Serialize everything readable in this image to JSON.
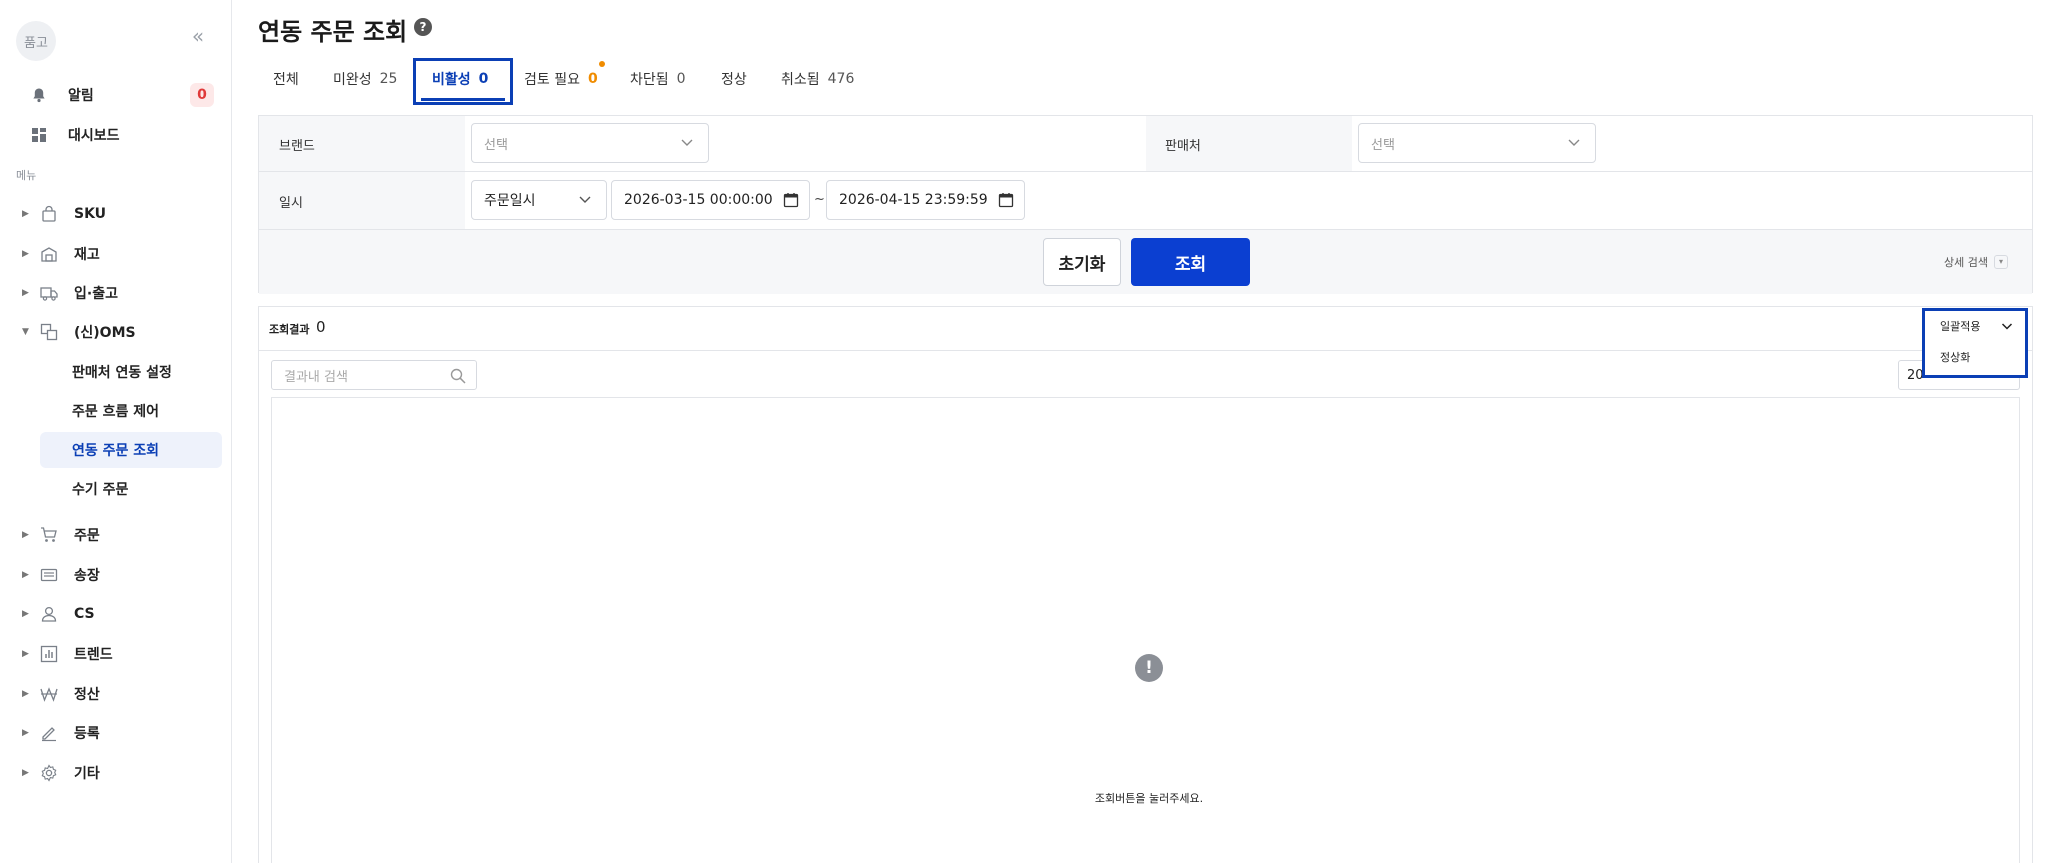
{
  "sidebar": {
    "brand": "품고",
    "notification_label": "알림",
    "notification_count": "0",
    "dashboard_label": "대시보드",
    "section_label": "메뉴",
    "items": [
      {
        "label": "SKU",
        "icon": "bag-icon"
      },
      {
        "label": "재고",
        "icon": "warehouse-icon"
      },
      {
        "label": "입·출고",
        "icon": "truck-icon"
      },
      {
        "label": "(신)OMS",
        "icon": "oms-icon"
      },
      {
        "label": "주문",
        "icon": "cart-icon"
      },
      {
        "label": "송장",
        "icon": "invoice-icon"
      },
      {
        "label": "CS",
        "icon": "user-icon"
      },
      {
        "label": "트렌드",
        "icon": "chart-icon"
      },
      {
        "label": "정산",
        "icon": "won-icon"
      },
      {
        "label": "등록",
        "icon": "pencil-icon"
      },
      {
        "label": "기타",
        "icon": "gear-icon"
      }
    ],
    "oms_subitems": [
      {
        "label": "판매처 연동 설정"
      },
      {
        "label": "주문 흐름 제어"
      },
      {
        "label": "연동 주문 조회"
      },
      {
        "label": "수기 주문"
      }
    ]
  },
  "header": {
    "title": "연동 주문 조회"
  },
  "tabs": [
    {
      "label": "전체",
      "count": ""
    },
    {
      "label": "미완성",
      "count": "25"
    },
    {
      "label": "비활성",
      "count": "0"
    },
    {
      "label": "검토 필요",
      "count": "0"
    },
    {
      "label": "차단됨",
      "count": "0"
    },
    {
      "label": "정상",
      "count": ""
    },
    {
      "label": "취소됨",
      "count": "476"
    }
  ],
  "filters": {
    "brand_label": "브랜드",
    "brand_placeholder": "선택",
    "seller_label": "판매처",
    "seller_placeholder": "선택",
    "date_label": "일시",
    "date_type": "주문일시",
    "date_from": "2026-03-15 00:00:00",
    "date_to": "2026-04-15 23:59:59",
    "tilde": "~",
    "reset_label": "초기화",
    "search_label": "조회",
    "advanced_label": "상세 검색"
  },
  "results": {
    "title": "조회결과",
    "count": "0",
    "search_placeholder": "결과내 검색",
    "page_size": "20",
    "empty_message": "조회버튼을 눌러주세요."
  },
  "bulk_dropdown": {
    "label": "일괄적용",
    "options": [
      "정상화"
    ]
  },
  "colors": {
    "accent": "#0b3fd1",
    "highlight": "#0b3fb5",
    "warning": "#f08c00",
    "danger": "#e03a3a"
  }
}
